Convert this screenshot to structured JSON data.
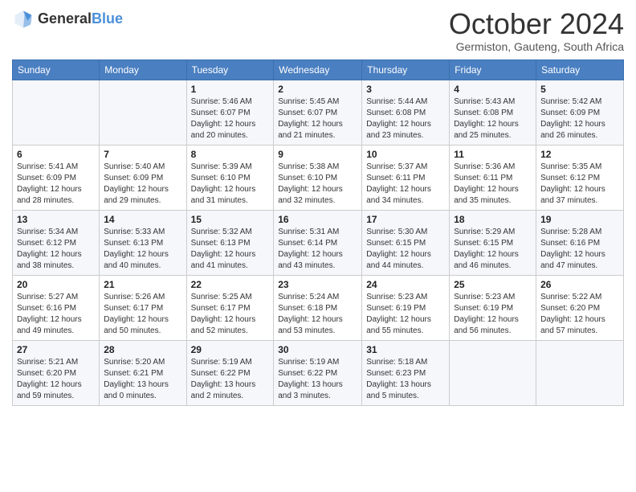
{
  "header": {
    "logo_general": "General",
    "logo_blue": "Blue",
    "month_title": "October 2024",
    "subtitle": "Germiston, Gauteng, South Africa"
  },
  "days_of_week": [
    "Sunday",
    "Monday",
    "Tuesday",
    "Wednesday",
    "Thursday",
    "Friday",
    "Saturday"
  ],
  "weeks": [
    [
      {
        "day": "",
        "info": ""
      },
      {
        "day": "",
        "info": ""
      },
      {
        "day": "1",
        "info": "Sunrise: 5:46 AM\nSunset: 6:07 PM\nDaylight: 12 hours and 20 minutes."
      },
      {
        "day": "2",
        "info": "Sunrise: 5:45 AM\nSunset: 6:07 PM\nDaylight: 12 hours and 21 minutes."
      },
      {
        "day": "3",
        "info": "Sunrise: 5:44 AM\nSunset: 6:08 PM\nDaylight: 12 hours and 23 minutes."
      },
      {
        "day": "4",
        "info": "Sunrise: 5:43 AM\nSunset: 6:08 PM\nDaylight: 12 hours and 25 minutes."
      },
      {
        "day": "5",
        "info": "Sunrise: 5:42 AM\nSunset: 6:09 PM\nDaylight: 12 hours and 26 minutes."
      }
    ],
    [
      {
        "day": "6",
        "info": "Sunrise: 5:41 AM\nSunset: 6:09 PM\nDaylight: 12 hours and 28 minutes."
      },
      {
        "day": "7",
        "info": "Sunrise: 5:40 AM\nSunset: 6:09 PM\nDaylight: 12 hours and 29 minutes."
      },
      {
        "day": "8",
        "info": "Sunrise: 5:39 AM\nSunset: 6:10 PM\nDaylight: 12 hours and 31 minutes."
      },
      {
        "day": "9",
        "info": "Sunrise: 5:38 AM\nSunset: 6:10 PM\nDaylight: 12 hours and 32 minutes."
      },
      {
        "day": "10",
        "info": "Sunrise: 5:37 AM\nSunset: 6:11 PM\nDaylight: 12 hours and 34 minutes."
      },
      {
        "day": "11",
        "info": "Sunrise: 5:36 AM\nSunset: 6:11 PM\nDaylight: 12 hours and 35 minutes."
      },
      {
        "day": "12",
        "info": "Sunrise: 5:35 AM\nSunset: 6:12 PM\nDaylight: 12 hours and 37 minutes."
      }
    ],
    [
      {
        "day": "13",
        "info": "Sunrise: 5:34 AM\nSunset: 6:12 PM\nDaylight: 12 hours and 38 minutes."
      },
      {
        "day": "14",
        "info": "Sunrise: 5:33 AM\nSunset: 6:13 PM\nDaylight: 12 hours and 40 minutes."
      },
      {
        "day": "15",
        "info": "Sunrise: 5:32 AM\nSunset: 6:13 PM\nDaylight: 12 hours and 41 minutes."
      },
      {
        "day": "16",
        "info": "Sunrise: 5:31 AM\nSunset: 6:14 PM\nDaylight: 12 hours and 43 minutes."
      },
      {
        "day": "17",
        "info": "Sunrise: 5:30 AM\nSunset: 6:15 PM\nDaylight: 12 hours and 44 minutes."
      },
      {
        "day": "18",
        "info": "Sunrise: 5:29 AM\nSunset: 6:15 PM\nDaylight: 12 hours and 46 minutes."
      },
      {
        "day": "19",
        "info": "Sunrise: 5:28 AM\nSunset: 6:16 PM\nDaylight: 12 hours and 47 minutes."
      }
    ],
    [
      {
        "day": "20",
        "info": "Sunrise: 5:27 AM\nSunset: 6:16 PM\nDaylight: 12 hours and 49 minutes."
      },
      {
        "day": "21",
        "info": "Sunrise: 5:26 AM\nSunset: 6:17 PM\nDaylight: 12 hours and 50 minutes."
      },
      {
        "day": "22",
        "info": "Sunrise: 5:25 AM\nSunset: 6:17 PM\nDaylight: 12 hours and 52 minutes."
      },
      {
        "day": "23",
        "info": "Sunrise: 5:24 AM\nSunset: 6:18 PM\nDaylight: 12 hours and 53 minutes."
      },
      {
        "day": "24",
        "info": "Sunrise: 5:23 AM\nSunset: 6:19 PM\nDaylight: 12 hours and 55 minutes."
      },
      {
        "day": "25",
        "info": "Sunrise: 5:23 AM\nSunset: 6:19 PM\nDaylight: 12 hours and 56 minutes."
      },
      {
        "day": "26",
        "info": "Sunrise: 5:22 AM\nSunset: 6:20 PM\nDaylight: 12 hours and 57 minutes."
      }
    ],
    [
      {
        "day": "27",
        "info": "Sunrise: 5:21 AM\nSunset: 6:20 PM\nDaylight: 12 hours and 59 minutes."
      },
      {
        "day": "28",
        "info": "Sunrise: 5:20 AM\nSunset: 6:21 PM\nDaylight: 13 hours and 0 minutes."
      },
      {
        "day": "29",
        "info": "Sunrise: 5:19 AM\nSunset: 6:22 PM\nDaylight: 13 hours and 2 minutes."
      },
      {
        "day": "30",
        "info": "Sunrise: 5:19 AM\nSunset: 6:22 PM\nDaylight: 13 hours and 3 minutes."
      },
      {
        "day": "31",
        "info": "Sunrise: 5:18 AM\nSunset: 6:23 PM\nDaylight: 13 hours and 5 minutes."
      },
      {
        "day": "",
        "info": ""
      },
      {
        "day": "",
        "info": ""
      }
    ]
  ]
}
